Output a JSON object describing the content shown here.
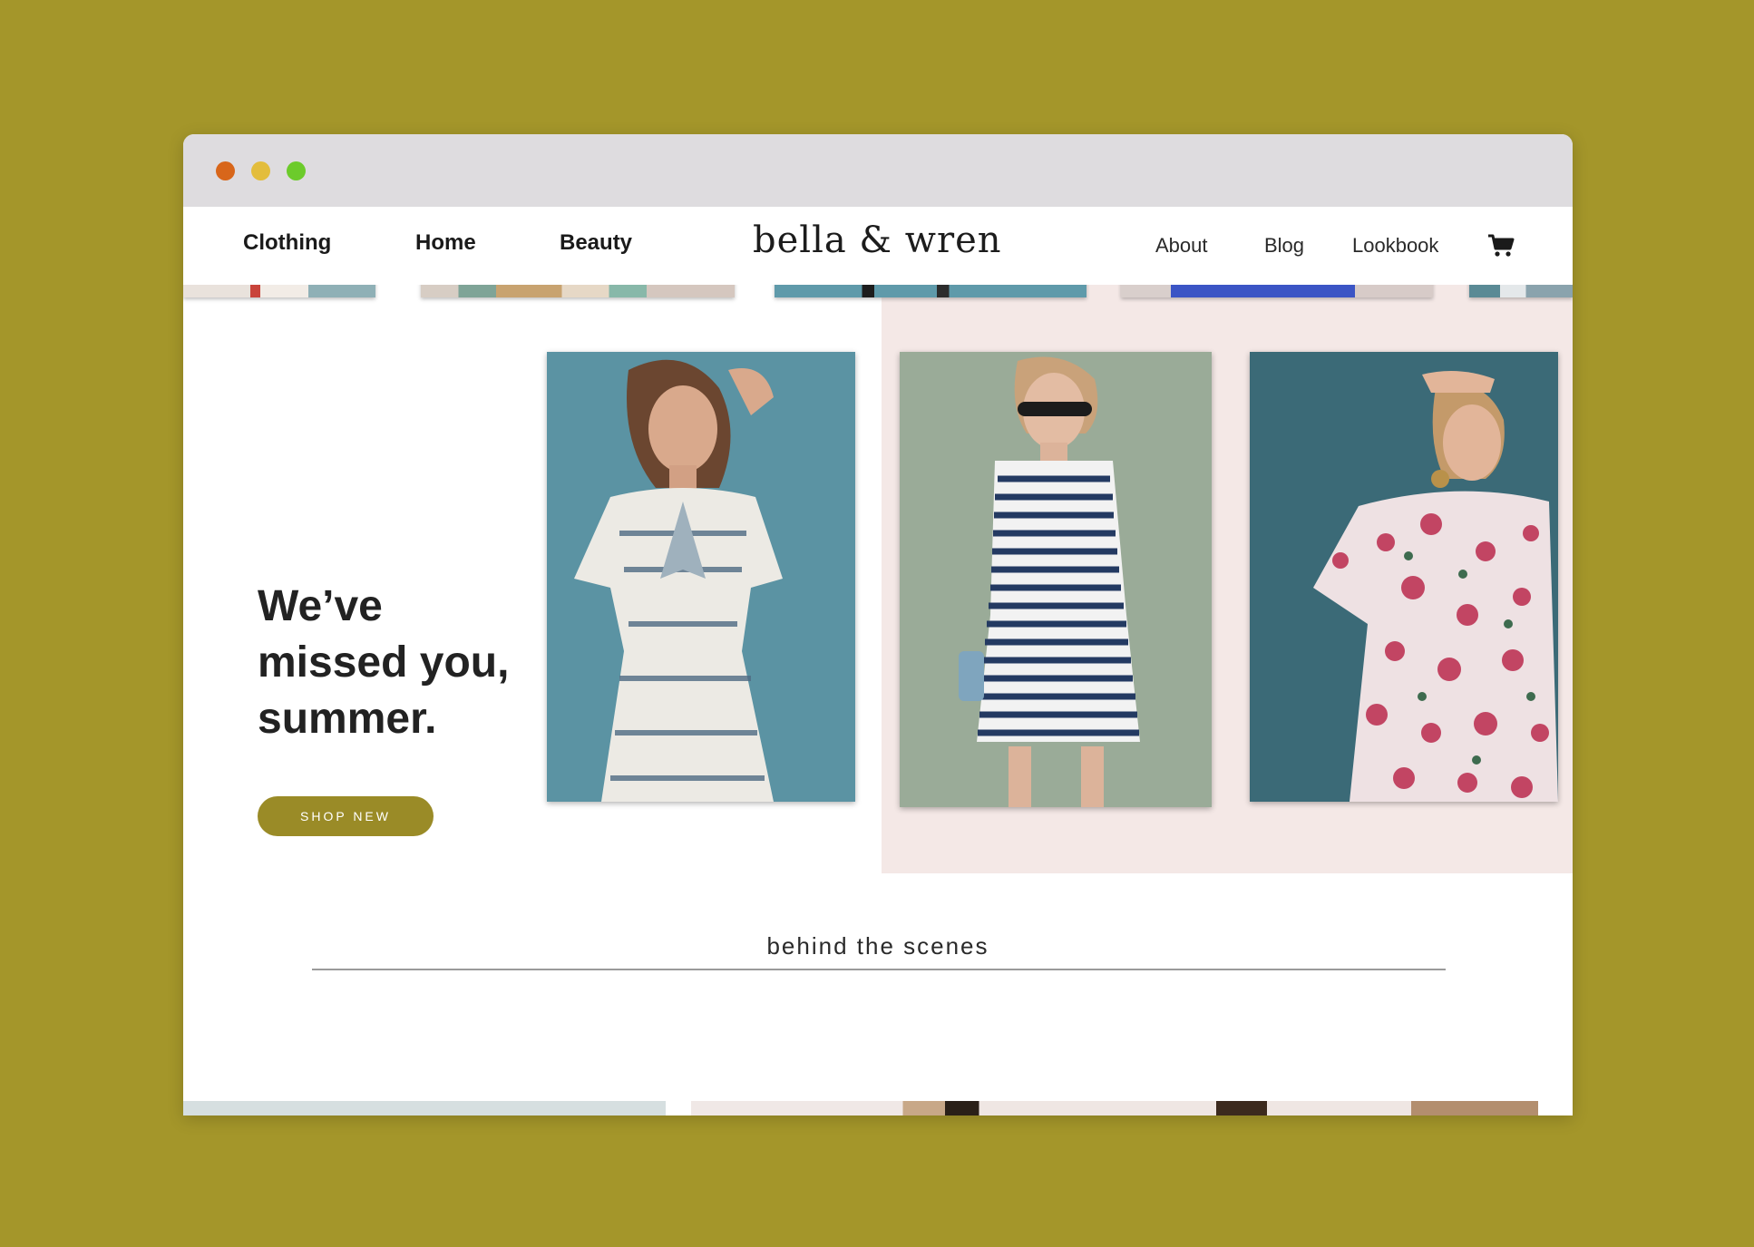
{
  "brand": {
    "logo_text": "bella & wren"
  },
  "nav": {
    "left": [
      "Clothing",
      "Home",
      "Beauty"
    ],
    "right": [
      "About",
      "Blog",
      "Lookbook"
    ],
    "cart_icon": "cart-icon"
  },
  "hero": {
    "heading_lines": [
      "We’ve",
      "missed you,",
      "summer."
    ],
    "cta_label": "SHOP NEW"
  },
  "behind": {
    "title": "behind the scenes"
  },
  "colors": {
    "background": "#a4962a",
    "accent": "#9a8b27",
    "panel": "#f4e8e6",
    "window_chrome": "#dedcdf"
  }
}
